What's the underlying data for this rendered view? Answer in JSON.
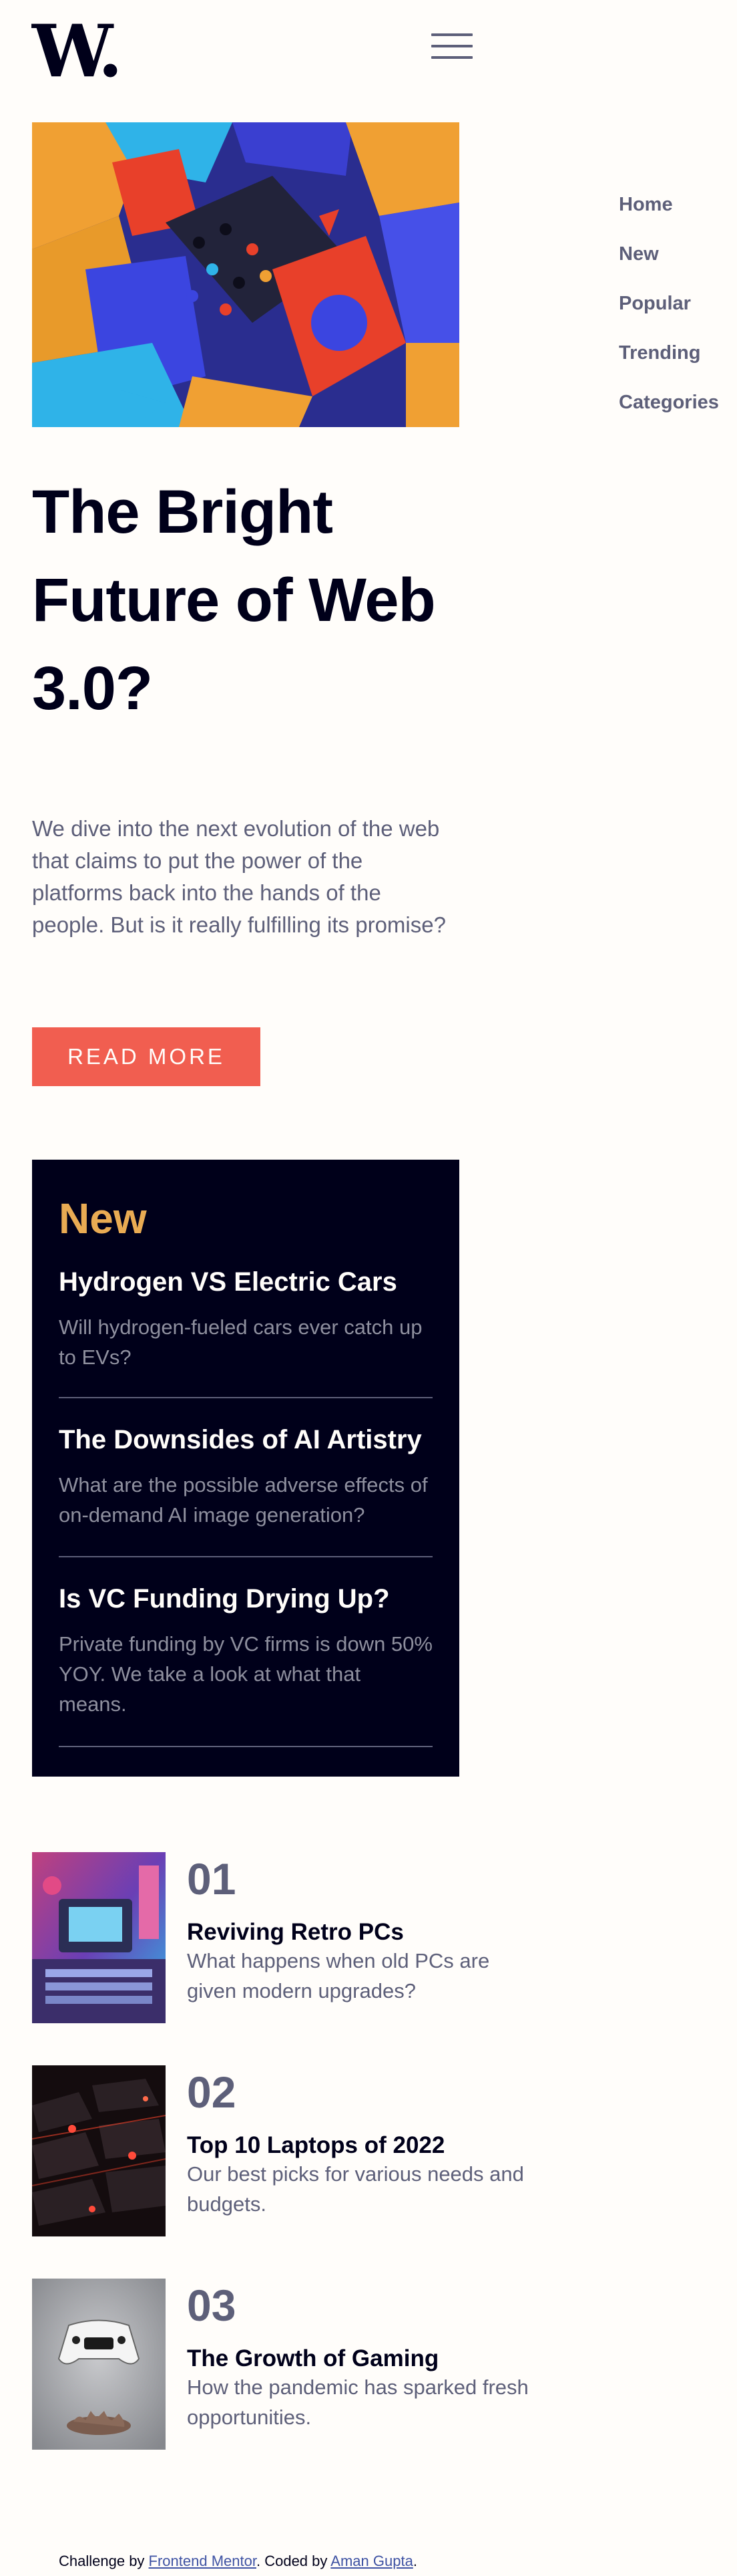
{
  "header": {
    "logo": "W.",
    "menu_icon": "hamburger-icon"
  },
  "nav": {
    "items": [
      {
        "label": "Home"
      },
      {
        "label": "New"
      },
      {
        "label": "Popular"
      },
      {
        "label": "Trending"
      },
      {
        "label": "Categories"
      }
    ]
  },
  "hero": {
    "title": "The Bright Future of Web 3.0?",
    "description": "We dive into the next evolution of the web that claims to put the power of the platforms back into the hands of the people. But is it really fulfilling its promise?",
    "button_label": "READ MORE"
  },
  "new_section": {
    "title": "New",
    "items": [
      {
        "title": "Hydrogen VS Electric Cars",
        "description": "Will hydrogen-fueled cars ever catch up to EVs?"
      },
      {
        "title": "The Downsides of AI Artistry",
        "description": "What are the possible adverse effects of on-demand AI image generation?"
      },
      {
        "title": "Is VC Funding Drying Up?",
        "description": "Private funding by VC firms is down 50% YOY. We take a look at what that means."
      }
    ]
  },
  "articles": [
    {
      "number": "01",
      "title": "Reviving Retro PCs",
      "description": "What happens when old PCs are given modern upgrades?"
    },
    {
      "number": "02",
      "title": "Top 10 Laptops of 2022",
      "description": "Our best picks for various needs and budgets."
    },
    {
      "number": "03",
      "title": "The Growth of Gaming",
      "description": "How the pandemic has sparked fresh opportunities."
    }
  ],
  "footer": {
    "prefix": "Challenge by ",
    "link1": "Frontend Mentor",
    "middle": ". Coded by ",
    "link2": "Aman Gupta",
    "suffix": "."
  },
  "colors": {
    "background": "#fffdfa",
    "dark": "#00001a",
    "accent_red": "#f15e50",
    "accent_orange": "#e9ab53",
    "grayish_blue": "#5d5f79"
  }
}
